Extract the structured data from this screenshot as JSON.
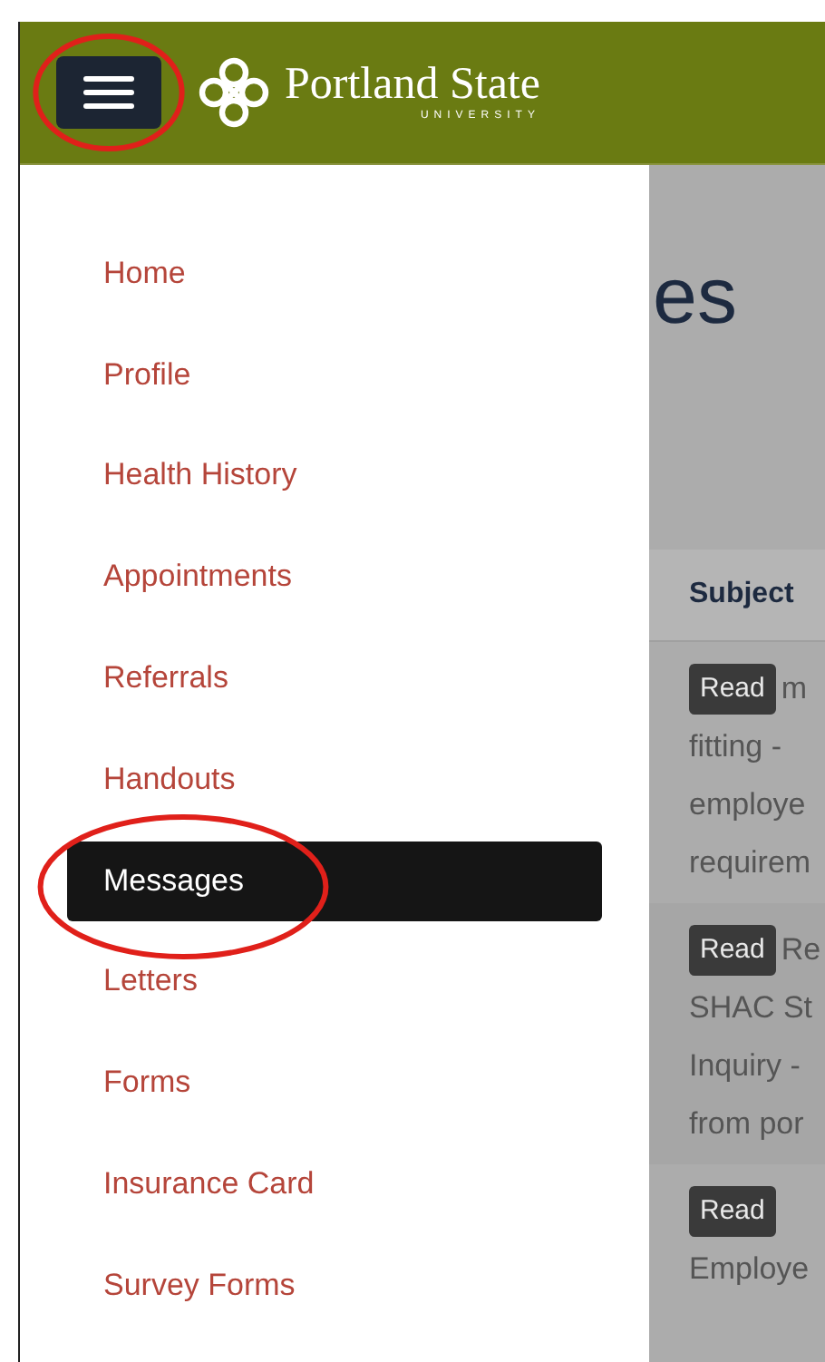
{
  "header": {
    "menu_button": {
      "circled": true
    },
    "brand": "Portland State",
    "brand_sub": "UNIVERSITY"
  },
  "nav": [
    {
      "label": "Home",
      "selected": false,
      "circled": false
    },
    {
      "label": "Profile",
      "selected": false,
      "circled": false
    },
    {
      "label": "Health History",
      "selected": false,
      "circled": false
    },
    {
      "label": "Appointments",
      "selected": false,
      "circled": false
    },
    {
      "label": "Referrals",
      "selected": false,
      "circled": false
    },
    {
      "label": "Handouts",
      "selected": false,
      "circled": false
    },
    {
      "label": "Messages",
      "selected": true,
      "circled": true
    },
    {
      "label": "Letters",
      "selected": false,
      "circled": false
    },
    {
      "label": "Forms",
      "selected": false,
      "circled": false
    },
    {
      "label": "Insurance Card",
      "selected": false,
      "circled": false
    },
    {
      "label": "Survey Forms",
      "selected": false,
      "circled": false
    }
  ],
  "page_title": "es",
  "table": {
    "columns": [
      "Subject"
    ],
    "rows": [
      {
        "badge": "Read",
        "first": "m",
        "lines": [
          "fitting -",
          "employe",
          "requirem"
        ]
      },
      {
        "badge": "Read",
        "first": "Re",
        "lines": [
          "SHAC St",
          "Inquiry -",
          "from por"
        ]
      },
      {
        "badge": "Read",
        "first": "",
        "lines": [
          "Employe"
        ]
      }
    ]
  }
}
